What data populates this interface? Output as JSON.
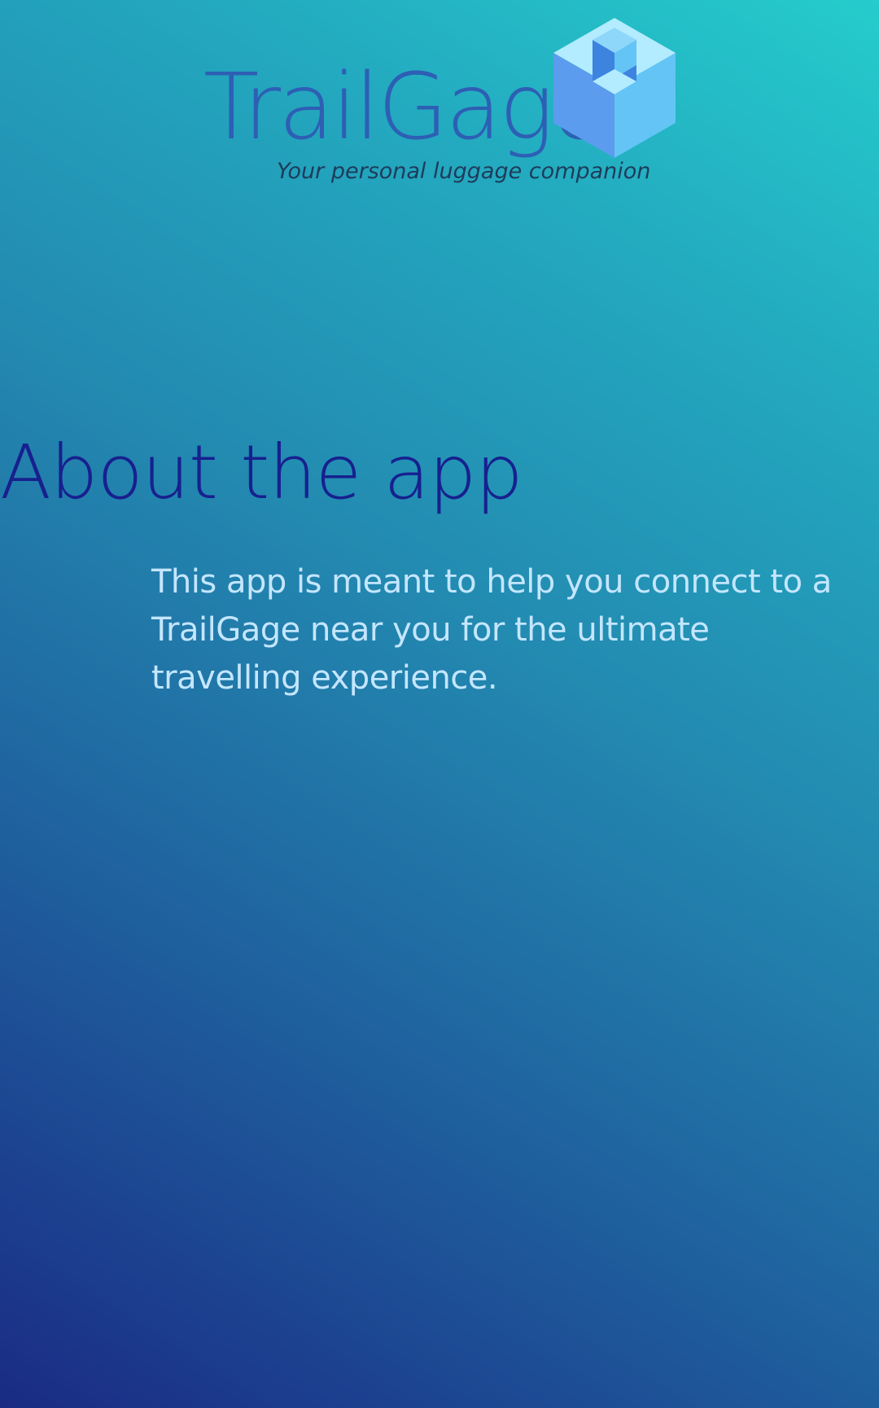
{
  "brand": {
    "name": "TrailGage",
    "tagline": "Your personal luggage companion",
    "logo_icon": "cube-icon",
    "colors": {
      "wordmark": "#2d5fb4",
      "cube_top": "#b3ecff",
      "cube_left": "#5b9cee",
      "cube_right": "#64c4f5"
    }
  },
  "about": {
    "title": "About the app",
    "body": "This app is meant to help you connect to a TrailGage near you for the ultimate travelling experience."
  },
  "theme": {
    "gradient_start": "#25cccc",
    "gradient_end": "#1a2b84",
    "title_color": "#17208f",
    "body_color": "#c4e6ff"
  }
}
